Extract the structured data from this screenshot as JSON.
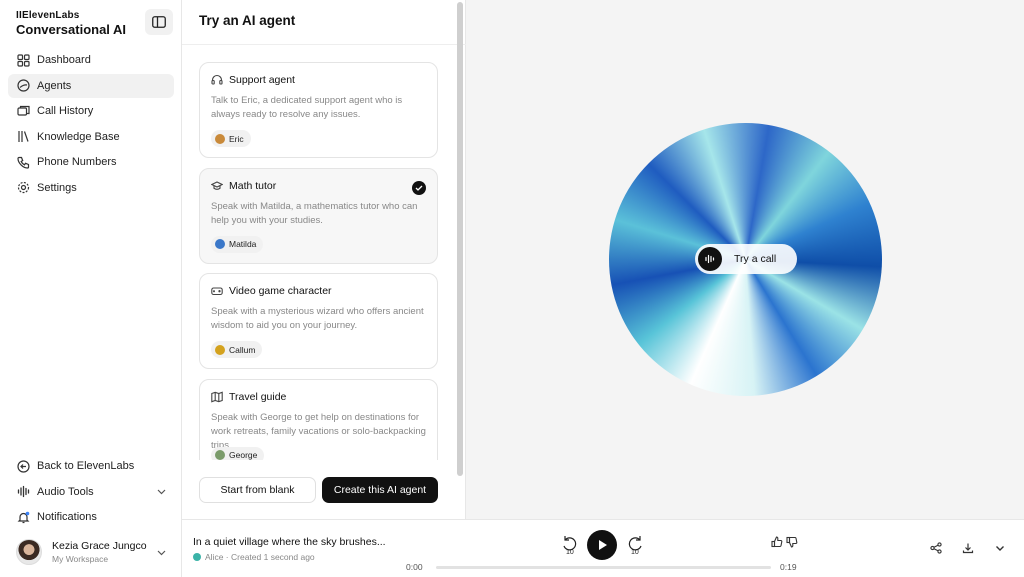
{
  "brand": {
    "small": "IIElevenLabs",
    "big": "Conversational AI"
  },
  "nav": [
    {
      "label": "Dashboard",
      "icon": "grid-icon",
      "active": false
    },
    {
      "label": "Agents",
      "icon": "agent-icon",
      "active": true
    },
    {
      "label": "Call History",
      "icon": "chat-icon",
      "active": false
    },
    {
      "label": "Knowledge Base",
      "icon": "books-icon",
      "active": false
    },
    {
      "label": "Phone Numbers",
      "icon": "phone-icon",
      "active": false
    },
    {
      "label": "Settings",
      "icon": "gear-icon",
      "active": false
    }
  ],
  "bottom_nav": [
    {
      "label": "Back to ElevenLabs",
      "icon": "arrow-left-circle-icon"
    },
    {
      "label": "Audio Tools",
      "icon": "waveform-icon"
    },
    {
      "label": "Notifications",
      "icon": "bell-icon"
    }
  ],
  "user": {
    "name": "Kezia Grace Jungco",
    "workspace": "My Workspace"
  },
  "panel": {
    "title": "Try an AI agent"
  },
  "cards": [
    {
      "title": "Support agent",
      "icon": "headset-icon",
      "desc": "Talk to Eric, a dedicated support agent who is always ready to resolve any issues.",
      "voice": "Eric",
      "voice_color": "#c98a3a",
      "selected": false
    },
    {
      "title": "Math tutor",
      "icon": "graduation-cap-icon",
      "desc": "Speak with Matilda, a mathematics tutor who can help you with your studies.",
      "voice": "Matilda",
      "voice_color": "#3b78c9",
      "selected": true
    },
    {
      "title": "Video game character",
      "icon": "gamepad-icon",
      "desc": "Speak with a mysterious wizard who offers ancient wisdom to aid you on your journey.",
      "voice": "Callum",
      "voice_color": "#d4a21e",
      "selected": false
    },
    {
      "title": "Travel guide",
      "icon": "map-icon",
      "desc": "Speak with George to get help on destinations for work retreats, family vacations or solo-backpacking trips.",
      "voice": "George",
      "voice_color": "#7a9b6a",
      "selected": false
    }
  ],
  "buttons": {
    "blank": "Start from blank",
    "create": "Create this AI agent"
  },
  "stage": {
    "try_call": "Try a call"
  },
  "player": {
    "title": "In a quiet village where the sky brushes...",
    "voice": "Alice",
    "created": "Created 1 second ago",
    "time_current": "0:00",
    "time_total": "0:19",
    "progress": 0,
    "skip_back": "10",
    "skip_forward": "10"
  },
  "colors": {
    "accent": "#111111",
    "orb_primary": "#1f5cc0",
    "orb_secondary": "#7fd5dc"
  }
}
